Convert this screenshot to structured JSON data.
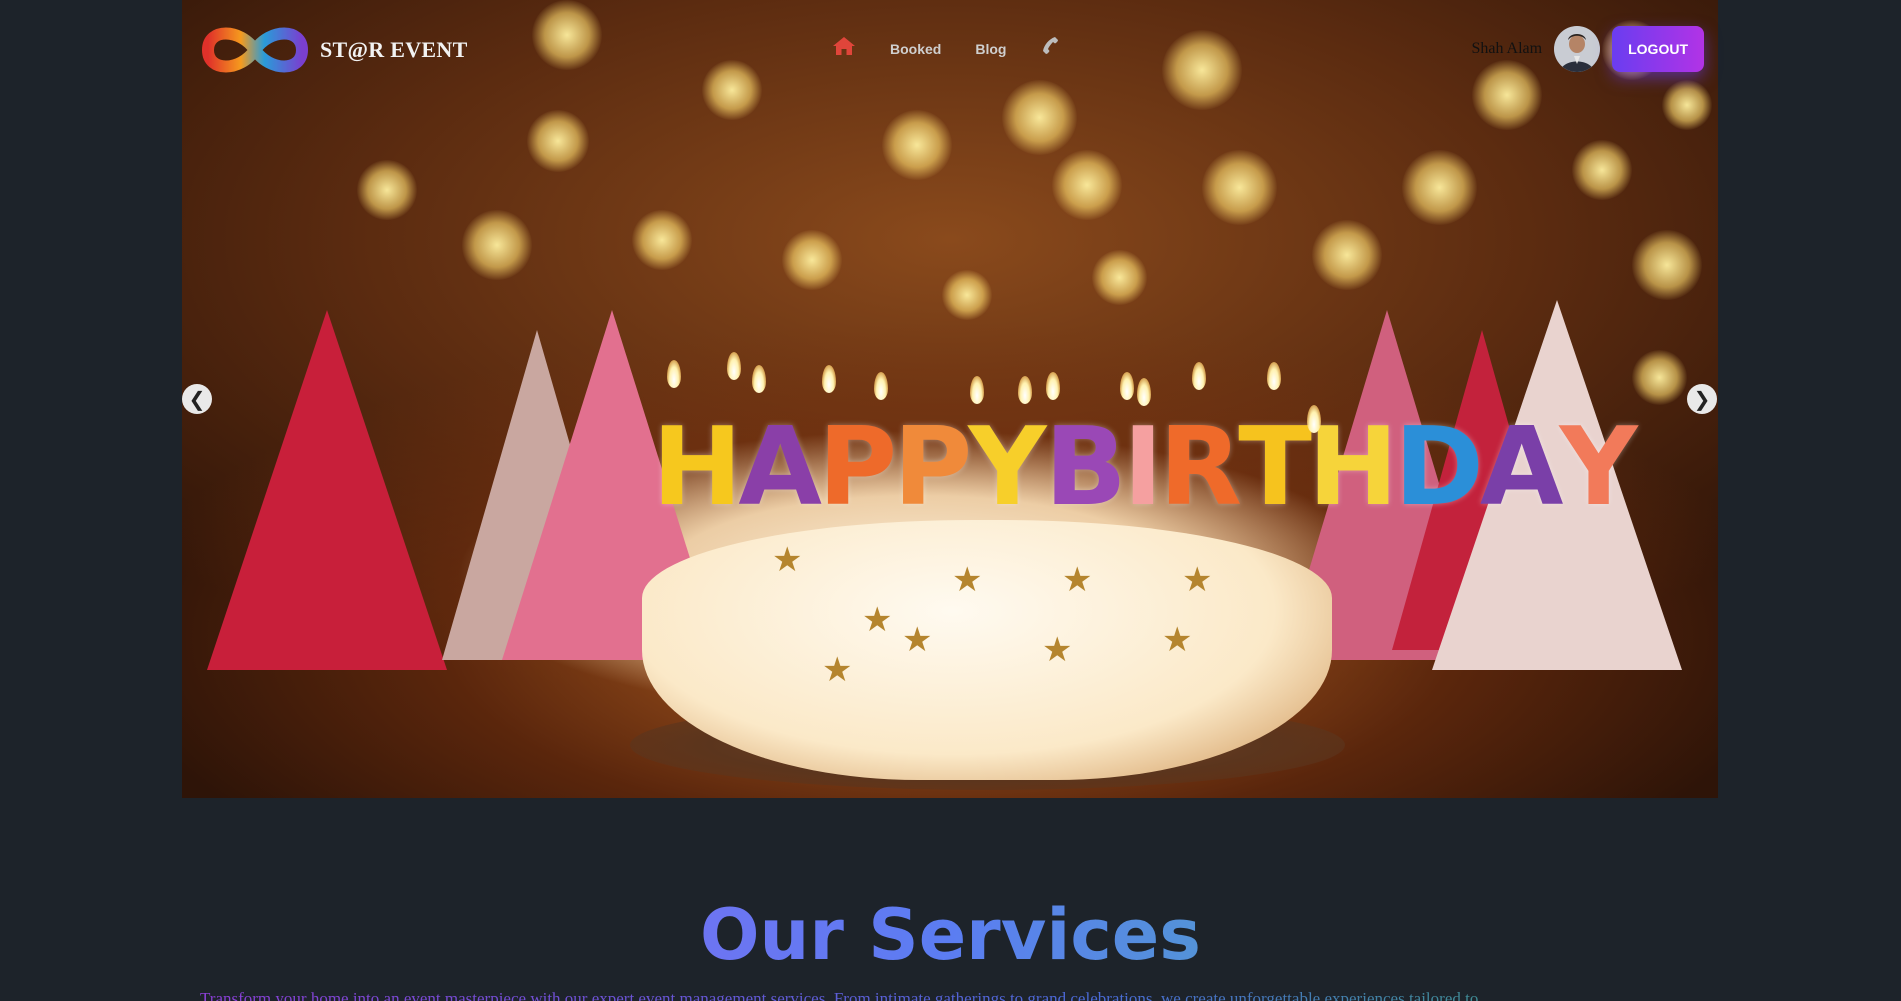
{
  "header": {
    "logo_text": "ST@R EVENT",
    "nav_links": [
      "Booked",
      "Blog"
    ],
    "user_name": "Shah Alam",
    "logout_label": "LOGOUT"
  },
  "hero": {
    "candle_text": "HAPPY BIRTHDAY",
    "prev_label": "❮",
    "next_label": "❯"
  },
  "services": {
    "title": "Our Services",
    "description": "Transform your home into an event masterpiece with our expert event management services. From intimate gatherings to grand celebrations, we create unforgettable experiences tailored to"
  },
  "colors": {
    "home_icon": "#e0453a",
    "logout_gradient_start": "#6a3df0",
    "logout_gradient_end": "#b233e6",
    "title_gradient": [
      "#9f5cf0",
      "#5b7df2",
      "#3ecf8e"
    ],
    "page_background": "#1d232a"
  },
  "icons": {
    "home": "home-icon",
    "phone": "phone-icon",
    "prev": "chevron-left-icon",
    "next": "chevron-right-icon"
  }
}
